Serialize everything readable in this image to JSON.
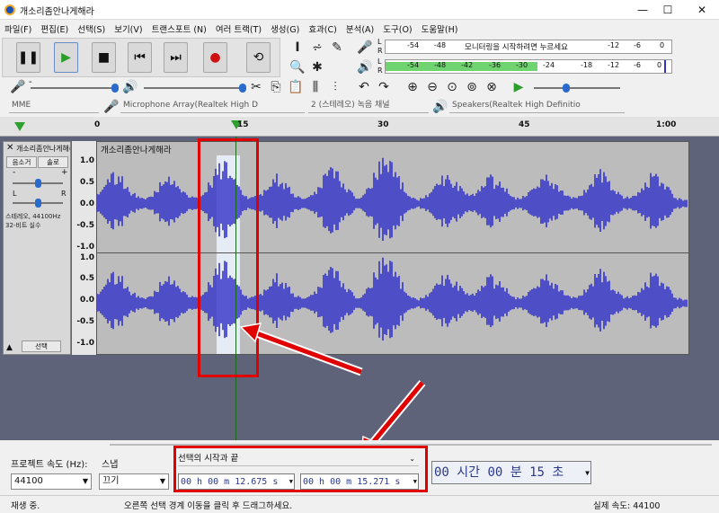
{
  "window": {
    "title": "개소리좀안나게해라",
    "minimize": "—",
    "maximize": "☐",
    "close": "✕"
  },
  "menu": [
    "파일(F)",
    "편집(E)",
    "선택(S)",
    "보기(V)",
    "트랜스포트 (N)",
    "여러 트랙(T)",
    "생성(G)",
    "효과(C)",
    "분석(A)",
    "도구(O)",
    "도움말(H)"
  ],
  "meters": {
    "record_l": "L",
    "record_r": "R",
    "play_l": "L",
    "play_r": "R",
    "record_hint": "모니터링을 시작하려면 누르세요",
    "rec_ticks": [
      "-54",
      "-48",
      "-12",
      "-6",
      "0"
    ],
    "play_ticks": [
      "-54",
      "-48",
      "-42",
      "-36",
      "-30",
      "-24",
      "-18",
      "-12",
      "-6",
      "0"
    ],
    "play_fill_pct": 53
  },
  "device": {
    "host": "MME",
    "mic": "Microphone Array(Realtek High D",
    "channels": "2 (스테레오) 녹음 채널",
    "speaker": "Speakers(Realtek High Definitio"
  },
  "ruler": {
    "ticks": [
      "0",
      "15",
      "30",
      "45",
      "1:00"
    ]
  },
  "track": {
    "name": "개소리좀안나게해라",
    "close": "✕",
    "mute": "음소거",
    "solo": "솔로",
    "gain_minus": "-",
    "gain_plus": "+",
    "pan_l": "L",
    "pan_r": "R",
    "info": "스테레오, 44100Hz\n32-비트 실수",
    "collapse": "▲",
    "select": "선택",
    "clip_title": "개소리좀안나게해라",
    "scale": [
      "1.0",
      "0.5",
      "0.0",
      "-0.5",
      "-1.0"
    ]
  },
  "bottom": {
    "rate_label": "프로젝트 속도 (Hz):",
    "snap_label": "스냅",
    "rate_value": "44100",
    "snap_value": "끄기",
    "sel_mode": "선택의 시작과 끝",
    "sel_start": "00 h 00 m 12.675 s",
    "sel_end": "00 h 00 m 15.271 s",
    "position": "00 시간 00 분 15 초"
  },
  "status": {
    "left": "재생 중.",
    "mid": "오른쪽 선택 경계 이동을 클릭 후 드래그하세요.",
    "right": "실제 속도: 44100"
  },
  "colors": {
    "wave": "#3232c8",
    "selection": "#e6ecf5",
    "highlight": "#e00000",
    "meter_green": "#6fd36f"
  }
}
